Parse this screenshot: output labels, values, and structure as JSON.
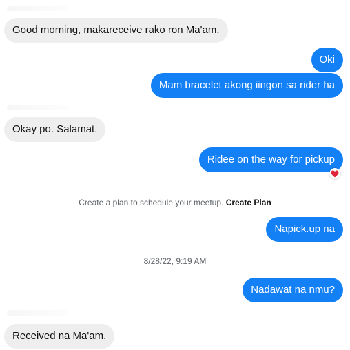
{
  "messages": {
    "m1": "Good morning, makareceive rako ron Ma'am.",
    "m2": "Oki",
    "m3": "Mam bracelet akong iingon sa rider ha",
    "m4": "Okay po. Salamat.",
    "m5": "Ridee on the way for pickup",
    "m6": "Napick.up na",
    "m7": "Nadawat na nmu?",
    "m8": "Received na Ma'am."
  },
  "system": {
    "plan_text": "Create a plan to schedule your meetup.",
    "plan_link": "Create Plan",
    "timestamp": "8/28/22, 9:19 AM"
  },
  "colors": {
    "outgoing_bubble": "#1480f6",
    "incoming_bubble": "#eeeeee",
    "reaction_heart": "#e0243a"
  },
  "reactions": {
    "m5": "heart-icon"
  }
}
